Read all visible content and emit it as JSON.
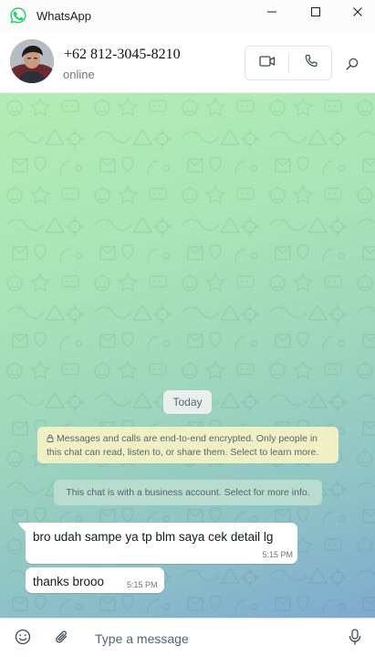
{
  "window": {
    "title": "WhatsApp",
    "controls": [
      "minimize-icon",
      "maximize-icon",
      "close-icon"
    ]
  },
  "header": {
    "contact_name": "+62 812-3045-8210",
    "status": "online",
    "actions": [
      "video-call-icon",
      "phone-icon",
      "search-icon"
    ]
  },
  "chat": {
    "date_label": "Today",
    "encryption_notice": "Messages and calls are end-to-end encrypted. Only people in this chat can read, listen to, or share them. Select to learn more.",
    "business_notice": "This chat is with a business account. Select for more info.",
    "messages": [
      {
        "text": "bro udah sampe ya tp blm saya cek detail lg",
        "time": "5:15 PM"
      },
      {
        "text": "thanks brooo",
        "time": "5:15 PM"
      }
    ]
  },
  "composer": {
    "placeholder": "Type a message",
    "icons": [
      "emoji-icon",
      "paperclip-icon",
      "microphone-icon"
    ]
  },
  "colors": {
    "brand": "#25d366",
    "wallpaper_top": "#b5ecb6",
    "wallpaper_bottom": "#7fa9cf",
    "encryption_bg": "#f1f0c4",
    "bubble_bg": "#ffffff"
  }
}
